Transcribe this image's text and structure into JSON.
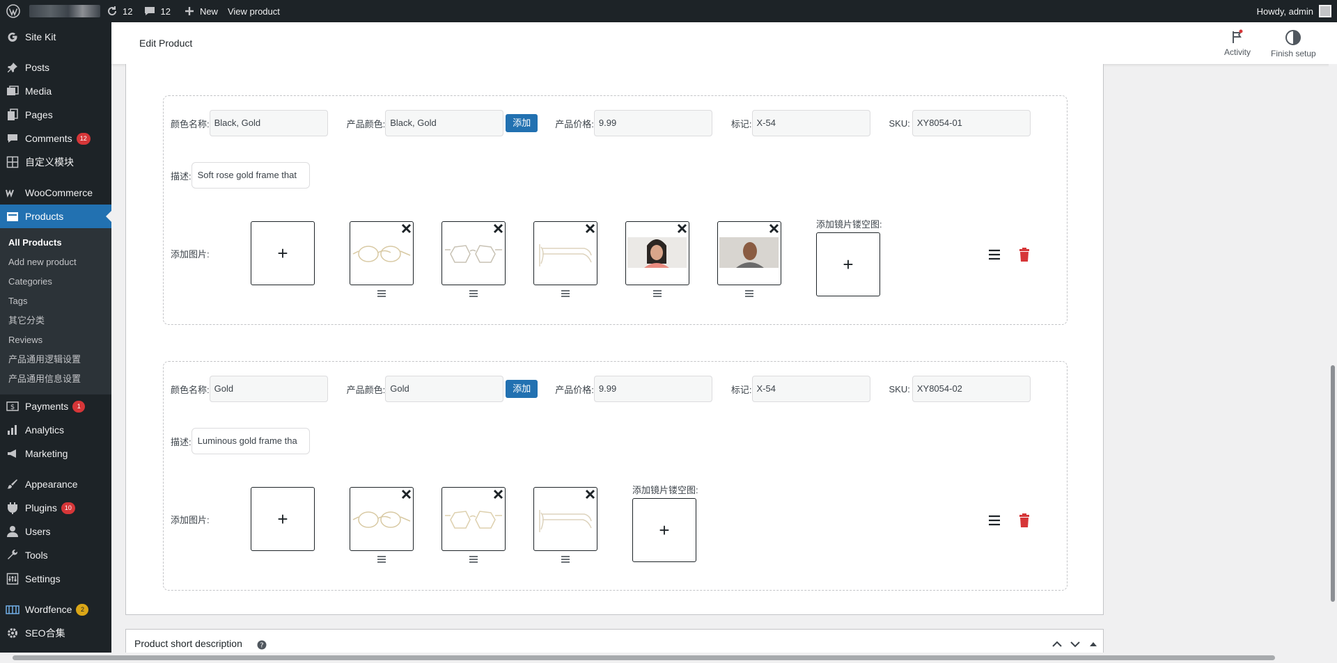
{
  "adminbar": {
    "updates_count": "12",
    "comments_count": "12",
    "new_label": "New",
    "view_label": "View product",
    "howdy": "Howdy, admin"
  },
  "sidebar": {
    "items_top": [
      {
        "label": "Site Kit",
        "icon": "g-icon"
      },
      {
        "label": "Posts",
        "icon": "pushpin-icon"
      },
      {
        "label": "Media",
        "icon": "media-icon"
      },
      {
        "label": "Pages",
        "icon": "pages-icon"
      },
      {
        "label": "Comments",
        "icon": "comment-icon",
        "badge": "12"
      },
      {
        "label": "自定义模块",
        "icon": "grid-icon"
      },
      {
        "label": "WooCommerce",
        "icon": "woo-icon"
      }
    ],
    "products_label": "Products",
    "submenu": [
      "All Products",
      "Add new product",
      "Categories",
      "Tags",
      "其它分类",
      "Reviews",
      "产品通用逻辑设置",
      "产品通用信息设置"
    ],
    "items_bottom": [
      {
        "label": "Payments",
        "icon": "payments-icon",
        "badge": "1"
      },
      {
        "label": "Analytics",
        "icon": "chart-icon"
      },
      {
        "label": "Marketing",
        "icon": "megaphone-icon"
      },
      {
        "label": "Appearance",
        "icon": "brush-icon"
      },
      {
        "label": "Plugins",
        "icon": "plug-icon",
        "badge": "10"
      },
      {
        "label": "Users",
        "icon": "user-icon"
      },
      {
        "label": "Tools",
        "icon": "wrench-icon"
      },
      {
        "label": "Settings",
        "icon": "settings-icon"
      },
      {
        "label": "Wordfence",
        "icon": "wordfence-icon",
        "badge": "2"
      },
      {
        "label": "SEO合集",
        "icon": "gear-icon"
      }
    ]
  },
  "header": {
    "title": "Edit Product",
    "activity": "Activity",
    "finish_setup": "Finish setup"
  },
  "labels": {
    "color_name": "颜色名称:",
    "product_color": "产品颜色:",
    "add": "添加",
    "price": "产品价格:",
    "mark": "标记:",
    "sku": "SKU:",
    "desc": "描述:",
    "add_images": "添加图片:",
    "add_cutout": "添加镜片镂空图:"
  },
  "variants": [
    {
      "color_name": "Black, Gold",
      "product_color": "Black, Gold",
      "price": "9.99",
      "mark": "X-54",
      "sku": "XY8054-01",
      "description": "Soft rose gold frame that",
      "images": [
        "glasses-front-thumb",
        "glasses-front-thumb",
        "glasses-side-thumb",
        "woman-model-thumb",
        "man-model-thumb"
      ]
    },
    {
      "color_name": "Gold",
      "product_color": "Gold",
      "price": "9.99",
      "mark": "X-54",
      "sku": "XY8054-02",
      "description": "Luminous gold frame tha",
      "images": [
        "glasses-front-thumb",
        "glasses-front-thumb",
        "glasses-side-thumb"
      ]
    }
  ],
  "short_description": {
    "title": "Product short description"
  },
  "colors": {
    "accent": "#2271b1",
    "admin_bg": "#1d2327",
    "delete": "#d63638",
    "badge": "#d63638",
    "badge_warn": "#dba617"
  }
}
